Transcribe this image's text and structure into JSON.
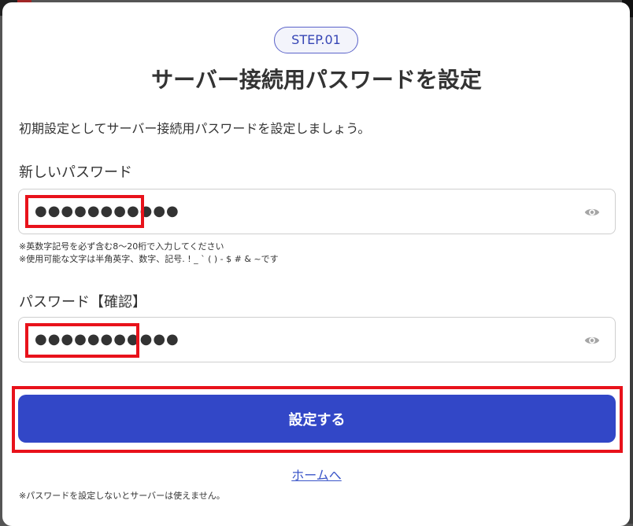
{
  "step_badge": "STEP.01",
  "title": "サーバー接続用パスワードを設定",
  "intro": "初期設定としてサーバー接続用パスワードを設定しましょう。",
  "new_password": {
    "label": "新しいパスワード",
    "value": "●●●●●●●●●●●",
    "toggle_icon": "eye-icon"
  },
  "notes": [
    "※英数字記号を必ず含む8～20桁で入力してください",
    "※使用可能な文字は半角英字、数字、記号. ! _ ` ( ) - $ # & ~です"
  ],
  "confirm_password": {
    "label": "パスワード【確認】",
    "value": "●●●●●●●●●●●",
    "toggle_icon": "eye-icon"
  },
  "submit_label": "設定する",
  "home_link": "ホームへ",
  "footer_note": "※パスワードを設定しないとサーバーは使えません。",
  "colors": {
    "primary": "#3247c7",
    "highlight": "#e8121b",
    "link": "#3a55c8"
  }
}
